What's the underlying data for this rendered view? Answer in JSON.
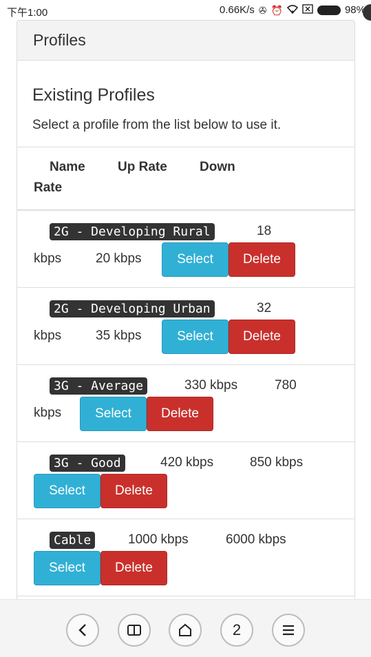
{
  "status_bar": {
    "time": "下午1:00",
    "speed": "0.66K/s",
    "battery_pct": "98%"
  },
  "header": {
    "title": "Profiles"
  },
  "section": {
    "title": "Existing Profiles",
    "description": "Select a profile from the list below to use it."
  },
  "table": {
    "headers": {
      "name": "Name",
      "up_rate": "Up Rate",
      "down_line1": "Down",
      "down_line2": "Rate"
    },
    "rows": [
      {
        "name": "2G - Developing Rural",
        "up_a": "18",
        "up_b": "kbps",
        "down": "20 kbps"
      },
      {
        "name": "2G - Developing Urban",
        "up_a": "32",
        "up_b": "kbps",
        "down": "35 kbps"
      },
      {
        "name": "3G - Average",
        "up": "330 kbps",
        "down_a": "780",
        "down_b": "kbps"
      },
      {
        "name": "3G - Good",
        "up": "420 kbps",
        "down": "850 kbps"
      },
      {
        "name": "Cable",
        "up": "1000 kbps",
        "down": "6000 kbps"
      }
    ],
    "select_label": "Select",
    "delete_label": "Delete"
  },
  "bottom_nav": {
    "tabs_count": "2"
  }
}
